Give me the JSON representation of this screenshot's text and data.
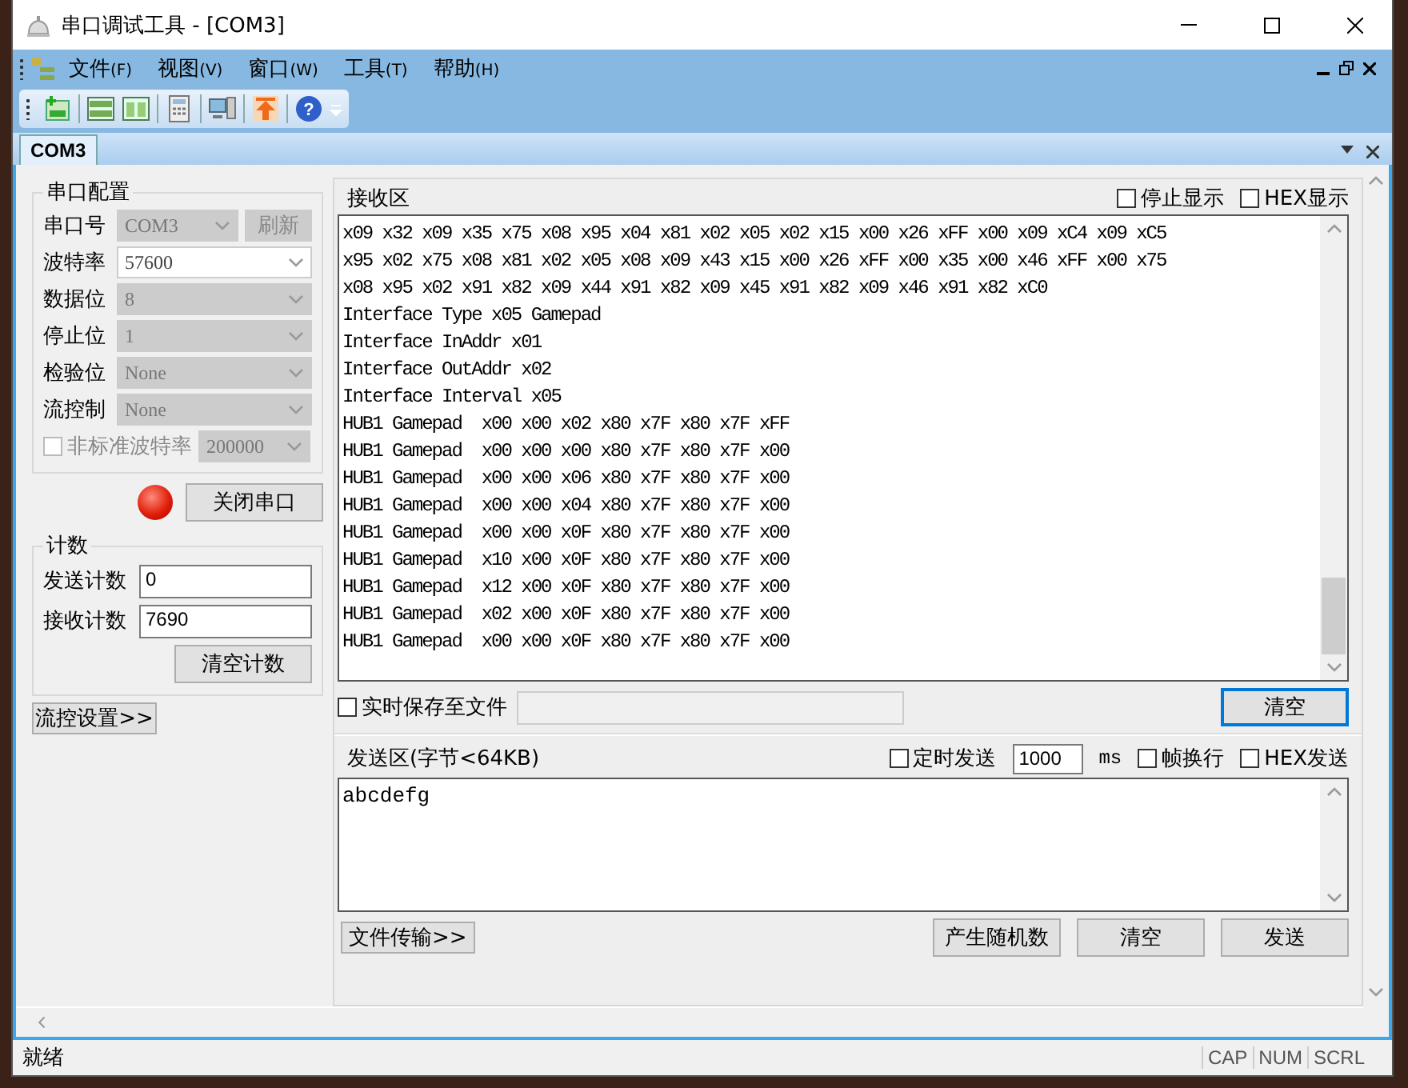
{
  "window": {
    "title": "串口调试工具 - [COM3]"
  },
  "menu": [
    {
      "label": "文件",
      "accel": "(F)"
    },
    {
      "label": "视图",
      "accel": "(V)"
    },
    {
      "label": "窗口",
      "accel": "(W)"
    },
    {
      "label": "工具",
      "accel": "(T)"
    },
    {
      "label": "帮助",
      "accel": "(H)"
    }
  ],
  "toolbar": {
    "help_glyph": "?"
  },
  "tabs": [
    {
      "label": "COM3",
      "selected": true
    }
  ],
  "serial_config": {
    "title": "串口配置",
    "fields": [
      {
        "label": "串口号",
        "value": "COM3",
        "disabled": true,
        "button": "刷新"
      },
      {
        "label": "波特率",
        "value": "57600",
        "disabled": false
      },
      {
        "label": "数据位",
        "value": "8",
        "disabled": true
      },
      {
        "label": "停止位",
        "value": "1",
        "disabled": true
      },
      {
        "label": "检验位",
        "value": "None",
        "disabled": true
      },
      {
        "label": "流控制",
        "value": "None",
        "disabled": true
      }
    ],
    "custom_baud": {
      "label": "非标准波特率",
      "checked": false,
      "value": "200000"
    },
    "port_open": true,
    "toggle_button": "关闭串口"
  },
  "counters": {
    "title": "计数",
    "rows": [
      {
        "label": "发送计数",
        "value": "0"
      },
      {
        "label": "接收计数",
        "value": "7690"
      }
    ],
    "clear_button": "清空计数"
  },
  "flow_button": "流控设置>>",
  "receive": {
    "title": "接收区",
    "options": [
      {
        "label": "停止显示",
        "checked": false
      },
      {
        "label": "HEX显示",
        "checked": false
      }
    ],
    "lines": [
      "x09 x32 x09 x35 x75 x08 x95 x04 x81 x02 x05 x02 x15 x00 x26 xFF x00 x09 xC4 x09 xC5",
      "x95 x02 x75 x08 x81 x02 x05 x08 x09 x43 x15 x00 x26 xFF x00 x35 x00 x46 xFF x00 x75",
      "x08 x95 x02 x91 x82 x09 x44 x91 x82 x09 x45 x91 x82 x09 x46 x91 x82 xC0",
      "Interface Type x05 Gamepad",
      "Interface InAddr x01",
      "Interface OutAddr x02",
      "Interface Interval x05",
      "HUB1 Gamepad  x00 x00 x02 x80 x7F x80 x7F xFF",
      "HUB1 Gamepad  x00 x00 x00 x80 x7F x80 x7F x00",
      "HUB1 Gamepad  x00 x00 x06 x80 x7F x80 x7F x00",
      "HUB1 Gamepad  x00 x00 x04 x80 x7F x80 x7F x00",
      "HUB1 Gamepad  x00 x00 x0F x80 x7F x80 x7F x00",
      "HUB1 Gamepad  x10 x00 x0F x80 x7F x80 x7F x00",
      "HUB1 Gamepad  x12 x00 x0F x80 x7F x80 x7F x00",
      "HUB1 Gamepad  x02 x00 x0F x80 x7F x80 x7F x00",
      "HUB1 Gamepad  x00 x00 x0F x80 x7F x80 x7F x00"
    ],
    "save_to_file": {
      "label": "实时保存至文件",
      "checked": false
    },
    "clear_button": "清空"
  },
  "send": {
    "title": "发送区(字节<64KB)",
    "timed": {
      "label": "定时发送",
      "checked": false
    },
    "interval": "1000",
    "unit": "ms",
    "options": [
      {
        "label": "帧换行",
        "checked": false
      },
      {
        "label": "HEX发送",
        "checked": false
      }
    ],
    "text": "abcdefg",
    "file_button": "文件传输>>",
    "buttons": [
      "产生随机数",
      "清空",
      "发送"
    ]
  },
  "status_bar": {
    "text": "就绪",
    "indicators": [
      "CAP",
      "NUM",
      "SCRL"
    ]
  }
}
